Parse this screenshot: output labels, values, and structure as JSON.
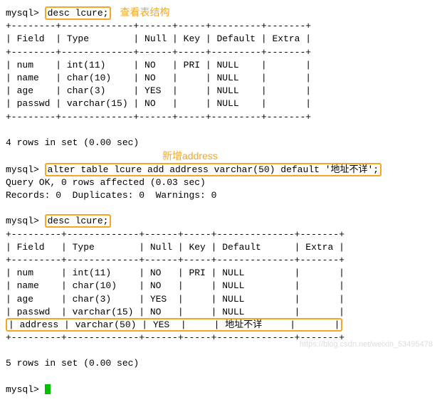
{
  "prompt": "mysql>",
  "commands": {
    "desc1": "desc lcure;",
    "alter": "alter table lcure add address varchar(50) default '地址不详';",
    "desc2": "desc lcure;"
  },
  "annotations": {
    "view_structure": "查看表结构",
    "add_address": "新增address"
  },
  "table1": {
    "separator": "+--------+-------------+------+-----+---------+-------+",
    "header": "| Field  | Type        | Null | Key | Default | Extra |",
    "rows": [
      "| num    | int(11)     | NO   | PRI | NULL    |       |",
      "| name   | char(10)    | NO   |     | NULL    |       |",
      "| age    | char(3)     | YES  |     | NULL    |       |",
      "| passwd | varchar(15) | NO   |     | NULL    |       |"
    ],
    "footer": "4 rows in set (0.00 sec)"
  },
  "alter_result": {
    "line1": "Query OK, 0 rows affected (0.03 sec)",
    "line2": "Records: 0  Duplicates: 0  Warnings: 0"
  },
  "table2": {
    "separator": "+---------+-------------+------+-----+--------------+-------+",
    "header": "| Field   | Type        | Null | Key | Default      | Extra |",
    "rows": [
      "| num     | int(11)     | NO   | PRI | NULL         |       |",
      "| name    | char(10)    | NO   |     | NULL         |       |",
      "| age     | char(3)     | YES  |     | NULL         |       |",
      "| passwd  | varchar(15) | NO   |     | NULL         |       |"
    ],
    "address_row": "| address | varchar(50) | YES  |     | 地址不详     |       |",
    "footer": "5 rows in set (0.00 sec)"
  },
  "watermark": "https://blog.csdn.net/weixin_53495478"
}
